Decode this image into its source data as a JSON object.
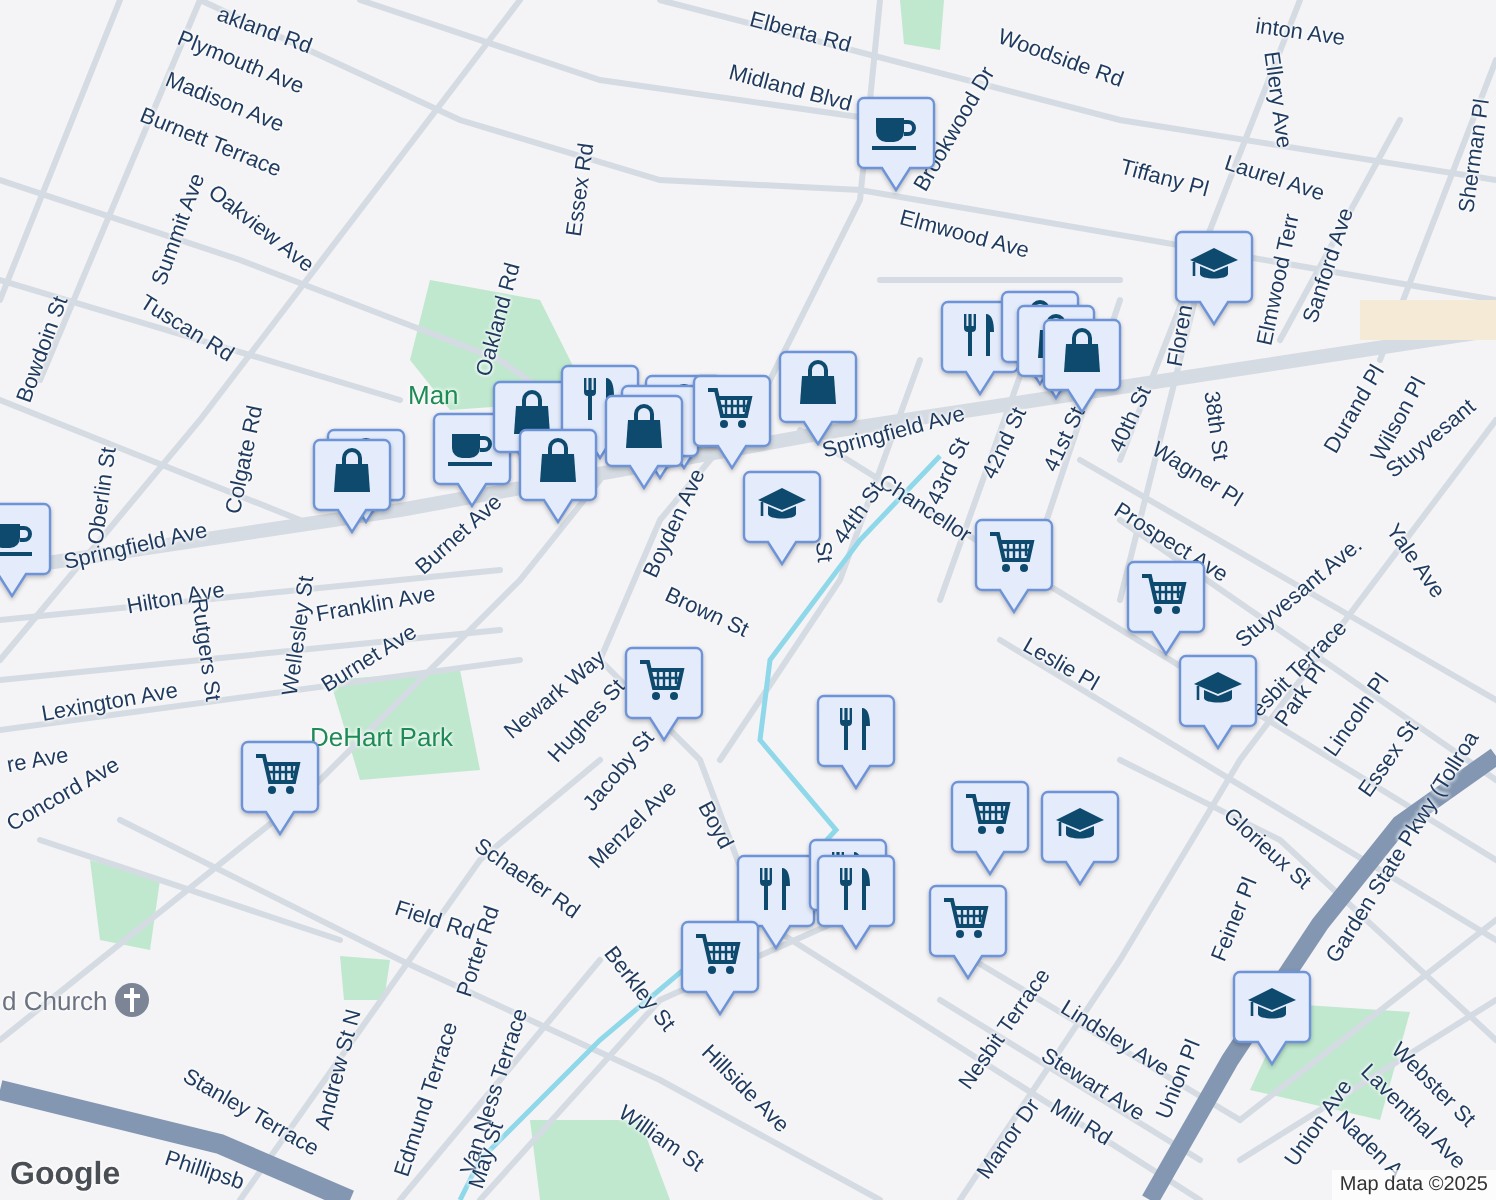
{
  "map": {
    "street_labels": [
      "akland Rd",
      "Plymouth Ave",
      "Madison Ave",
      "Burnett Terrace",
      "Summit Ave",
      "Oakview Ave",
      "Tuscan Rd",
      "Bowdoin St",
      "Oakland Rd",
      "Essex Rd",
      "Elberta Rd",
      "Midland Blvd",
      "Woodside Rd",
      "inton Ave",
      "Ellery Ave",
      "Sherman Pl",
      "Laurel Ave",
      "Tiffany Pl",
      "Elmwood Ave",
      "Brookwood Dr",
      "Elmwood Terr",
      "Sanford Ave",
      "Floren",
      "Springfield Ave",
      "Springfield Ave",
      "Chancellor",
      "44th St",
      "43rd St",
      "42nd St",
      "41st St",
      "40th St",
      "38th St",
      "Wagner Pl",
      "Prospect Ave",
      "Durand Pl",
      "Wilson Pl",
      "Stuyvesant",
      "Stuyvesant Ave.",
      "Yale Ave",
      "Boyden Ave",
      "Brown St",
      "St",
      "Hilton Ave",
      "Franklin Ave",
      "Burnet Ave",
      "Burnet Ave",
      "Wellesley St",
      "Colgate Rd",
      "Oberlin St",
      "Rutgers St",
      "Lexington Ave",
      "Concord Ave",
      "re Ave",
      "Newark Way",
      "Hughes St",
      "Jacoby St",
      "Menzel Ave",
      "Schaefer Rd",
      "Boyd",
      "Field Rd",
      "Porter Rd",
      "Andrew St N",
      "Edmund Terrace",
      "Van Ness Terrace",
      "May St",
      "Stanley Terrace",
      "Phillipsb",
      "Berkley St",
      "Hillside Ave",
      "William St",
      "Nesbit Terrace",
      "Lindsley Ave",
      "Stewart Ave",
      "Mill Rd",
      "Manor Dr",
      "Union Pl",
      "Union Ave",
      "Webster St",
      "Laventhal Ave",
      "Naden A",
      "Leslie Pl",
      "esbit Terrace",
      "Park Pl",
      "Lincoln Pl",
      "Essex St",
      "Glorieux St",
      "Feiner Pl",
      "Garden State Pkwy (Tollroa"
    ],
    "place_labels": [
      {
        "text": "Man",
        "kind": "park"
      },
      {
        "text": "DeHart Park",
        "kind": "park"
      },
      {
        "text": "d Church",
        "kind": "church"
      }
    ],
    "markers": [
      {
        "kind": "cafe"
      },
      {
        "kind": "cafe"
      },
      {
        "kind": "shopping"
      },
      {
        "kind": "shopping"
      },
      {
        "kind": "cafe"
      },
      {
        "kind": "shopping"
      },
      {
        "kind": "restaurant"
      },
      {
        "kind": "shopping"
      },
      {
        "kind": "shopping"
      },
      {
        "kind": "restaurant"
      },
      {
        "kind": "shopping"
      },
      {
        "kind": "grocery"
      },
      {
        "kind": "shopping"
      },
      {
        "kind": "school"
      },
      {
        "kind": "restaurant"
      },
      {
        "kind": "shopping"
      },
      {
        "kind": "shopping"
      },
      {
        "kind": "shopping"
      },
      {
        "kind": "school"
      },
      {
        "kind": "grocery"
      },
      {
        "kind": "grocery"
      },
      {
        "kind": "grocery"
      },
      {
        "kind": "grocery"
      },
      {
        "kind": "restaurant"
      },
      {
        "kind": "school"
      },
      {
        "kind": "grocery"
      },
      {
        "kind": "school"
      },
      {
        "kind": "restaurant"
      },
      {
        "kind": "restaurant"
      },
      {
        "kind": "restaurant"
      },
      {
        "kind": "grocery"
      },
      {
        "kind": "grocery"
      },
      {
        "kind": "school"
      }
    ],
    "logo": "Google",
    "attribution": "Map data ©2025"
  }
}
